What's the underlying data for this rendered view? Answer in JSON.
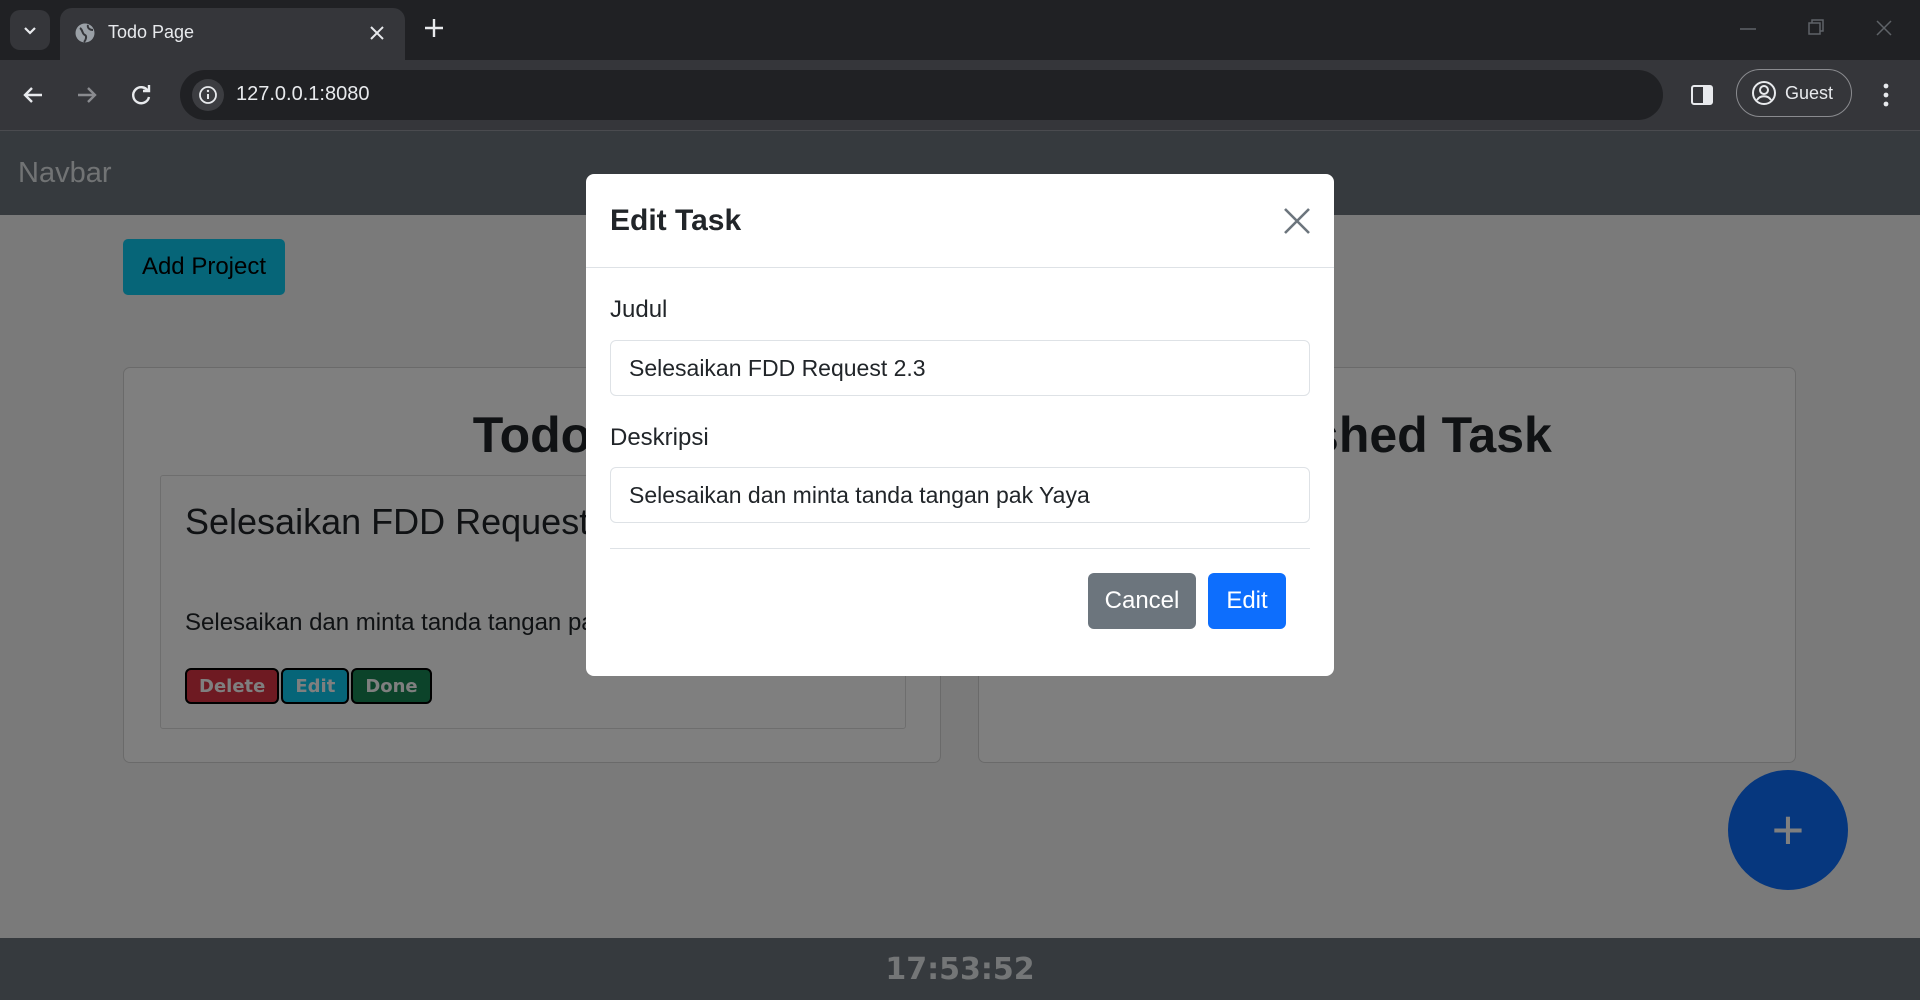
{
  "browser": {
    "tab_title": "Todo Page",
    "url": "127.0.0.1:8080",
    "profile_label": "Guest"
  },
  "page": {
    "navbar_brand": "Navbar",
    "add_project_label": "Add Project",
    "todo_heading": "Todo",
    "finished_heading": "Finished Task",
    "task": {
      "title": "Selesaikan FDD Request 2.3",
      "description": "Selesaikan dan minta tanda tangan pak Yaya",
      "delete_label": "Delete",
      "edit_label": "Edit",
      "done_label": "Done"
    },
    "fab_symbol": "+",
    "clock": "17:53:52"
  },
  "modal": {
    "title": "Edit Task",
    "judul_label": "Judul",
    "judul_value": "Selesaikan FDD Request 2.3",
    "deskripsi_label": "Deskripsi",
    "deskripsi_value": "Selesaikan dan minta tanda tangan pak Yaya",
    "cancel_label": "Cancel",
    "edit_label": "Edit"
  },
  "colors": {
    "info": "#0dcaf0",
    "primary": "#0d6efd",
    "secondary": "#6c757d",
    "danger": "#dc3545",
    "success": "#198754"
  }
}
